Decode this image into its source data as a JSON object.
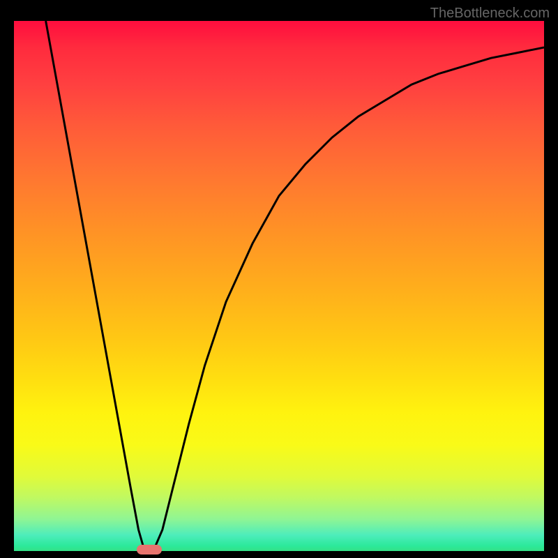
{
  "watermark": "TheBottleneck.com",
  "chart_data": {
    "type": "line",
    "x_range": [
      0,
      100
    ],
    "y_range": [
      0,
      100
    ],
    "curve_points": [
      {
        "x": 6,
        "y": 100
      },
      {
        "x": 8,
        "y": 89
      },
      {
        "x": 10,
        "y": 78
      },
      {
        "x": 12,
        "y": 67
      },
      {
        "x": 14,
        "y": 56
      },
      {
        "x": 16,
        "y": 45
      },
      {
        "x": 18,
        "y": 34
      },
      {
        "x": 20,
        "y": 23
      },
      {
        "x": 22,
        "y": 12
      },
      {
        "x": 23.5,
        "y": 4
      },
      {
        "x": 24.5,
        "y": 0.5
      },
      {
        "x": 25.5,
        "y": 0
      },
      {
        "x": 26.5,
        "y": 0.5
      },
      {
        "x": 28,
        "y": 4
      },
      {
        "x": 30,
        "y": 12
      },
      {
        "x": 33,
        "y": 24
      },
      {
        "x": 36,
        "y": 35
      },
      {
        "x": 40,
        "y": 47
      },
      {
        "x": 45,
        "y": 58
      },
      {
        "x": 50,
        "y": 67
      },
      {
        "x": 55,
        "y": 73
      },
      {
        "x": 60,
        "y": 78
      },
      {
        "x": 65,
        "y": 82
      },
      {
        "x": 70,
        "y": 85
      },
      {
        "x": 75,
        "y": 88
      },
      {
        "x": 80,
        "y": 90
      },
      {
        "x": 85,
        "y": 91.5
      },
      {
        "x": 90,
        "y": 93
      },
      {
        "x": 95,
        "y": 94
      },
      {
        "x": 100,
        "y": 95
      }
    ],
    "minimum_point": {
      "x": 25.5,
      "y": 0
    },
    "marker_position": {
      "x": 25.5,
      "y": 0
    },
    "gradient_colors": {
      "top": "#ff0d3e",
      "middle": "#ffc814",
      "bottom": "#34e286"
    },
    "title": "",
    "xlabel": "",
    "ylabel": ""
  }
}
